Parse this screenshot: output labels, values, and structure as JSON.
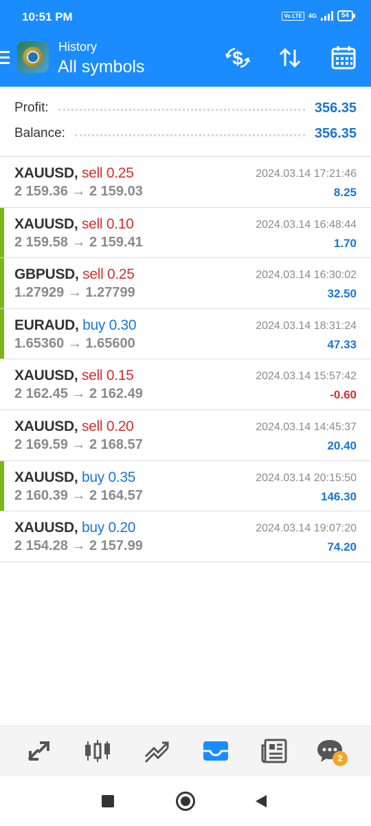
{
  "status_bar": {
    "time": "10:51 PM",
    "volte": "Vo LTE",
    "network": "4G",
    "battery": "54"
  },
  "header": {
    "subtitle": "History",
    "title": "All symbols",
    "icons": [
      "menu-icon",
      "app-logo-icon",
      "dollar-swap-icon",
      "sort-icon",
      "calendar-icon"
    ]
  },
  "summary": {
    "profit_label": "Profit:",
    "profit_value": "356.35",
    "balance_label": "Balance:",
    "balance_value": "356.35"
  },
  "deals": [
    {
      "symbol": "XAUUSD,",
      "side": "sell 0.25",
      "direction": "sell",
      "prices": "2 159.36 → 2 159.03",
      "time": "2024.03.14 17:21:46",
      "profit": "8.25",
      "marked": false
    },
    {
      "symbol": "XAUUSD,",
      "side": "sell 0.10",
      "direction": "sell",
      "prices": "2 159.58 → 2 159.41",
      "time": "2024.03.14 16:48:44",
      "profit": "1.70",
      "marked": true
    },
    {
      "symbol": "GBPUSD,",
      "side": "sell 0.25",
      "direction": "sell",
      "prices": "1.27929 → 1.27799",
      "time": "2024.03.14 16:30:02",
      "profit": "32.50",
      "marked": true
    },
    {
      "symbol": "EURAUD,",
      "side": "buy 0.30",
      "direction": "buy",
      "prices": "1.65360 → 1.65600",
      "time": "2024.03.14 18:31:24",
      "profit": "47.33",
      "marked": true
    },
    {
      "symbol": "XAUUSD,",
      "side": "sell 0.15",
      "direction": "sell",
      "prices": "2 162.45 → 2 162.49",
      "time": "2024.03.14 15:57:42",
      "profit": "-0.60",
      "marked": false
    },
    {
      "symbol": "XAUUSD,",
      "side": "sell 0.20",
      "direction": "sell",
      "prices": "2 169.59 → 2 168.57",
      "time": "2024.03.14 14:45:37",
      "profit": "20.40",
      "marked": false
    },
    {
      "symbol": "XAUUSD,",
      "side": "buy 0.35",
      "direction": "buy",
      "prices": "2 160.39 → 2 164.57",
      "time": "2024.03.14 20:15:50",
      "profit": "146.30",
      "marked": true
    },
    {
      "symbol": "XAUUSD,",
      "side": "buy 0.20",
      "direction": "buy",
      "prices": "2 154.28 → 2 157.99",
      "time": "2024.03.14 19:07:20",
      "profit": "74.20",
      "marked": false
    }
  ],
  "bottom_nav": {
    "items": [
      "quotes-icon",
      "chart-icon",
      "trade-icon",
      "history-icon",
      "news-icon",
      "chat-icon"
    ],
    "active": "history-icon",
    "chat_badge": "2"
  },
  "system_nav": [
    "recents-button",
    "home-button",
    "back-button"
  ],
  "colors": {
    "accent": "#1a8cff",
    "sell": "#d32f2f",
    "buy": "#1976d2",
    "marker": "#7cb518"
  }
}
